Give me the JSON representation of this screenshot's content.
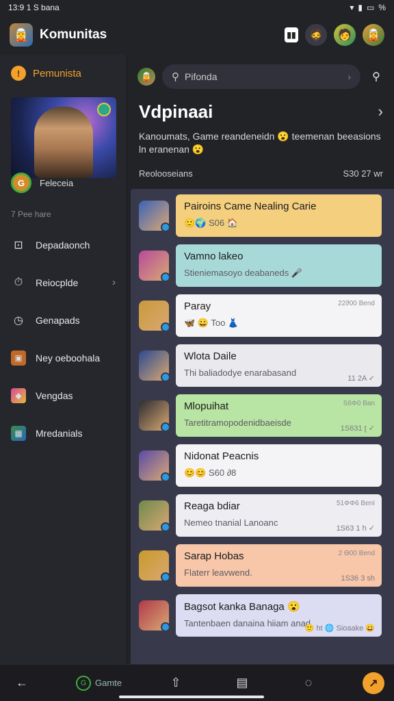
{
  "status": {
    "time": "13:9 1 S bana",
    "battery": "%"
  },
  "topbar": {
    "title": "Komunitas",
    "book_icon": "book-icon"
  },
  "sidebar": {
    "header": "Pemunista",
    "hero_caption": "Feleceia",
    "ring_label": "G",
    "section": "7 Pee hare",
    "items": [
      {
        "label": "Depadaonch",
        "icon": "inbox-icon"
      },
      {
        "label": "Reiocplde",
        "icon": "timer-icon"
      },
      {
        "label": "Genapads",
        "icon": "stopwatch-icon"
      },
      {
        "label": "Ney oeboohala",
        "icon": "game-image-icon"
      },
      {
        "label": "Vengdas",
        "icon": "puzzle-icon"
      },
      {
        "label": "Mredanials",
        "icon": "map-icon"
      }
    ]
  },
  "main": {
    "search_text": "Pifonda",
    "heading": "Vdpinaai",
    "description": "Kanoumats, Game reandeneidn 😮 teemenan beeasions ln eranenan 😮",
    "list_label": "Reolooseians",
    "list_count": "S30 27 wr"
  },
  "rows": [
    {
      "title": "Pairoins Came Nealing Carie",
      "sub": "🙂🌍 S06 🏠",
      "time": "",
      "meta": "",
      "color": "#f4cf7e",
      "ava": "#3b62b8"
    },
    {
      "title": "Vamno lakeo",
      "sub": "Stieniemasoyo deabaneds 🎤",
      "time": "",
      "meta": "",
      "color": "#a8d9d9",
      "ava": "#b74a9a"
    },
    {
      "title": "Paray",
      "sub": "🦋 😀 Too 👗",
      "time": "22ϑ00 Bend",
      "meta": "",
      "color": "#f4f4f6",
      "ava": "#c99a3a"
    },
    {
      "title": "Wlota Daile",
      "sub": "Thi baliadodye enarabasand",
      "time": "",
      "meta": "11 2A ✓",
      "color": "#e9e9ee",
      "ava": "#2b4a8f"
    },
    {
      "title": "Mlopuihat",
      "sub": "Taretitramopodenidbaeisde",
      "time": "S6Φ0 Ban",
      "meta": "1S631 ʈ ✓",
      "color": "#b8e5a3",
      "ava": "#2c2c30"
    },
    {
      "title": "Nidonat Peacnis",
      "sub": "😊😊 S60 ∂8",
      "time": "",
      "meta": "",
      "color": "#f4f4f6",
      "ava": "#5a4aa8"
    },
    {
      "title": "Reaga bdiar",
      "sub": "Nemeo tnanial Lanoanc",
      "time": "51ΦΦ6 BenI",
      "meta": "1S63 1 h ✓",
      "color": "#ededf2",
      "ava": "#6e8a4a"
    },
    {
      "title": "Sarap Hobas",
      "sub": "Flaterr leavwend.",
      "time": "2 Ѳ00 Bend",
      "meta": "1S36 3 ѕh",
      "color": "#f8c6a8",
      "ava": "#c99a2a"
    },
    {
      "title": "Bagsot kanka Banaga 😮",
      "sub": "Tantenbaen danaina hiiam anad",
      "time": "",
      "meta": "🙂 ht 🌐 Sioaake 😀",
      "color": "#dcdcf2",
      "ava": "#b03a4a"
    }
  ],
  "bottombar": {
    "games_label": "Gamte"
  }
}
